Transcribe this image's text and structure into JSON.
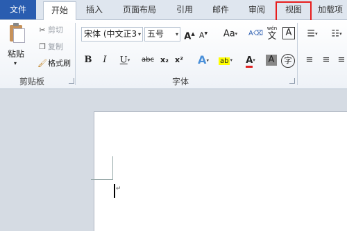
{
  "tabs": {
    "file": "文件",
    "home": "开始",
    "insert": "插入",
    "layout": "页面布局",
    "references": "引用",
    "mailings": "邮件",
    "review": "审阅",
    "view": "视图",
    "addins": "加载项"
  },
  "clipboard": {
    "paste": "粘贴",
    "cut": "剪切",
    "copy": "复制",
    "format_painter": "格式刷",
    "group_label": "剪贴板"
  },
  "font": {
    "font_name": "宋体 (中文正3",
    "font_size": "五号",
    "grow_label": "A",
    "shrink_label": "A",
    "case_label": "Aa",
    "bold": "B",
    "italic": "I",
    "underline": "U",
    "strikethrough": "abc",
    "subscript": "x₂",
    "superscript": "x²",
    "highlight_text": "ab",
    "color_text": "A",
    "shade_text": "A",
    "phonetic_top": "wén",
    "phonetic_char": "文",
    "border_char": "A",
    "enclose_char": "字",
    "group_label": "字体"
  },
  "colors": {
    "file_tab": "#2a5db0",
    "highlight_box": "#e81c1c",
    "font_color": "#e02020",
    "highlight_color": "#ffff00"
  },
  "icons": [
    "paste-icon",
    "cut-icon",
    "copy-icon",
    "format-painter-icon",
    "clear-format-icon",
    "text-effect-icon",
    "bullets-icon",
    "numbering-icon",
    "align-left-icon",
    "align-center-icon",
    "align-right-icon"
  ]
}
